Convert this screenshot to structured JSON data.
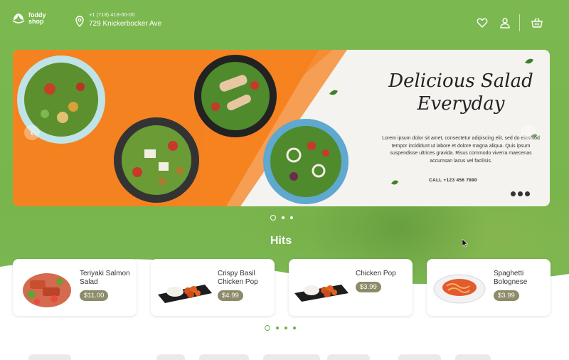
{
  "brand": {
    "line1": "foddy",
    "line2": "shop"
  },
  "header": {
    "phone": "+1 (718) 418-00-00",
    "address": "729 Knickerbocker Ave",
    "icons": [
      "location-pin-icon",
      "heart-icon",
      "user-icon",
      "basket-icon"
    ]
  },
  "banner": {
    "headline_line1": "Delicious Salad",
    "headline_line2": "Everyday",
    "blurb": "Lorem ipsum dolor sit amet, consectetur adipiscing elit, sed do eiusmod tempor incididunt ut labore et dolore magna aliqua. Quis ipsum suspendisse ultrices gravida. Risus commodo viverra maecenas accumsan lacus vel facilisis.",
    "call": "CALL +123 456 7890",
    "social_icons": [
      "twitter-icon",
      "facebook-icon",
      "instagram-icon"
    ],
    "prev_icon": "chevron-left-icon",
    "next_icon": "chevron-right-icon",
    "slide_count": 3,
    "active_slide": 1
  },
  "section": {
    "title": "Hits"
  },
  "products": [
    {
      "name": "Teriyaki Salmon Salad",
      "price": "$11.00"
    },
    {
      "name": "Crispy Basil Chicken Pop",
      "price": "$4.99"
    },
    {
      "name": "Chicken Pop",
      "price": "$3.99"
    },
    {
      "name": "Spaghetti Bolognese",
      "price": "$3.99"
    }
  ],
  "products_pager": {
    "page_count": 4,
    "active_page": 1
  },
  "colors": {
    "brand_green": "#7ab84e",
    "accent_orange": "#f58220",
    "price_badge": "#8c8c6a"
  }
}
